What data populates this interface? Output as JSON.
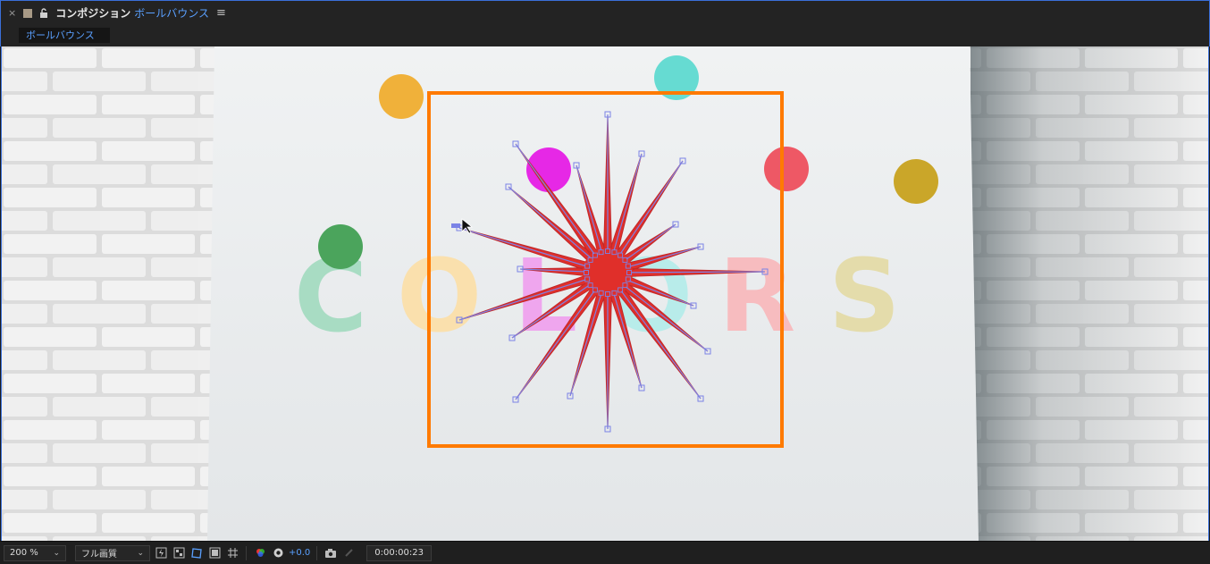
{
  "panel": {
    "close_glyph": "×",
    "title": "コンポジション",
    "comp_name": "ボールバウンス",
    "menu_glyph": "≡"
  },
  "tab": {
    "label": "ボールバウンス"
  },
  "canvas": {
    "text": "COLORS",
    "colors": {
      "orange_ball": "#f0b13a",
      "teal_ball": "#66dbd2",
      "magenta_ball": "#e628e6",
      "red_ball": "#ee5865",
      "gold_ball": "#caa629",
      "green_ball": "#4ba45c",
      "star_fill": "#e02f2a",
      "bounding_box": "#ff7a00",
      "path_line": "#7b83e6"
    }
  },
  "toolbar": {
    "zoom": "200 %",
    "resolution": "フル画質",
    "exposure": "+0.0",
    "timecode": "0:00:00:23"
  }
}
